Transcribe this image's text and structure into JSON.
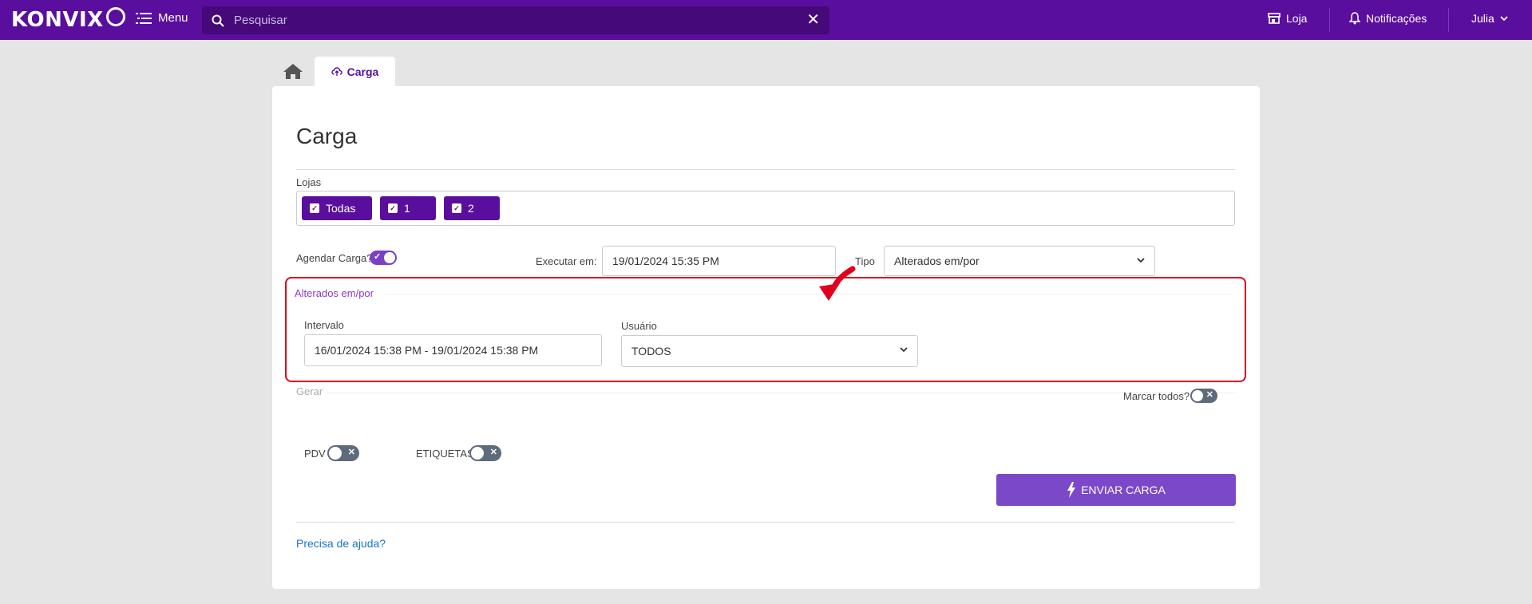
{
  "header": {
    "logo_text": "KONVIX",
    "menu_label": "Menu",
    "search_placeholder": "Pesquisar",
    "store_label": "Loja",
    "notifications_label": "Notificações",
    "user_name": "Julia"
  },
  "tabs": {
    "active_label": "Carga"
  },
  "page": {
    "title": "Carga",
    "lojas_label": "Lojas",
    "lojas_chips": [
      "Todas",
      "1",
      "2"
    ],
    "agendar_label": "Agendar Carga?",
    "agendar_on": true,
    "executar_label": "Executar em:",
    "executar_value": "19/01/2024 15:35 PM",
    "tipo_label": "Tipo",
    "tipo_value": "Alterados em/por",
    "section_legend": "Alterados em/por",
    "intervalo_label": "Intervalo",
    "intervalo_value": "16/01/2024 15:38 PM - 19/01/2024 15:38 PM",
    "usuario_label": "Usuário",
    "usuario_value": "TODOS",
    "gerar_label": "Gerar",
    "marcar_todos_label": "Marcar todos?",
    "marcar_todos_on": false,
    "pdv_label": "PDV",
    "pdv_on": false,
    "etiquetas_label": "ETIQUETAS",
    "etiquetas_on": false,
    "send_button_label": "ENVIAR CARGA",
    "help_link": "Precisa de ajuda?"
  },
  "colors": {
    "brand": "#5a0e9e",
    "accent_button": "#7b49c8",
    "highlight": "#e0001b",
    "link": "#1a73c9"
  }
}
